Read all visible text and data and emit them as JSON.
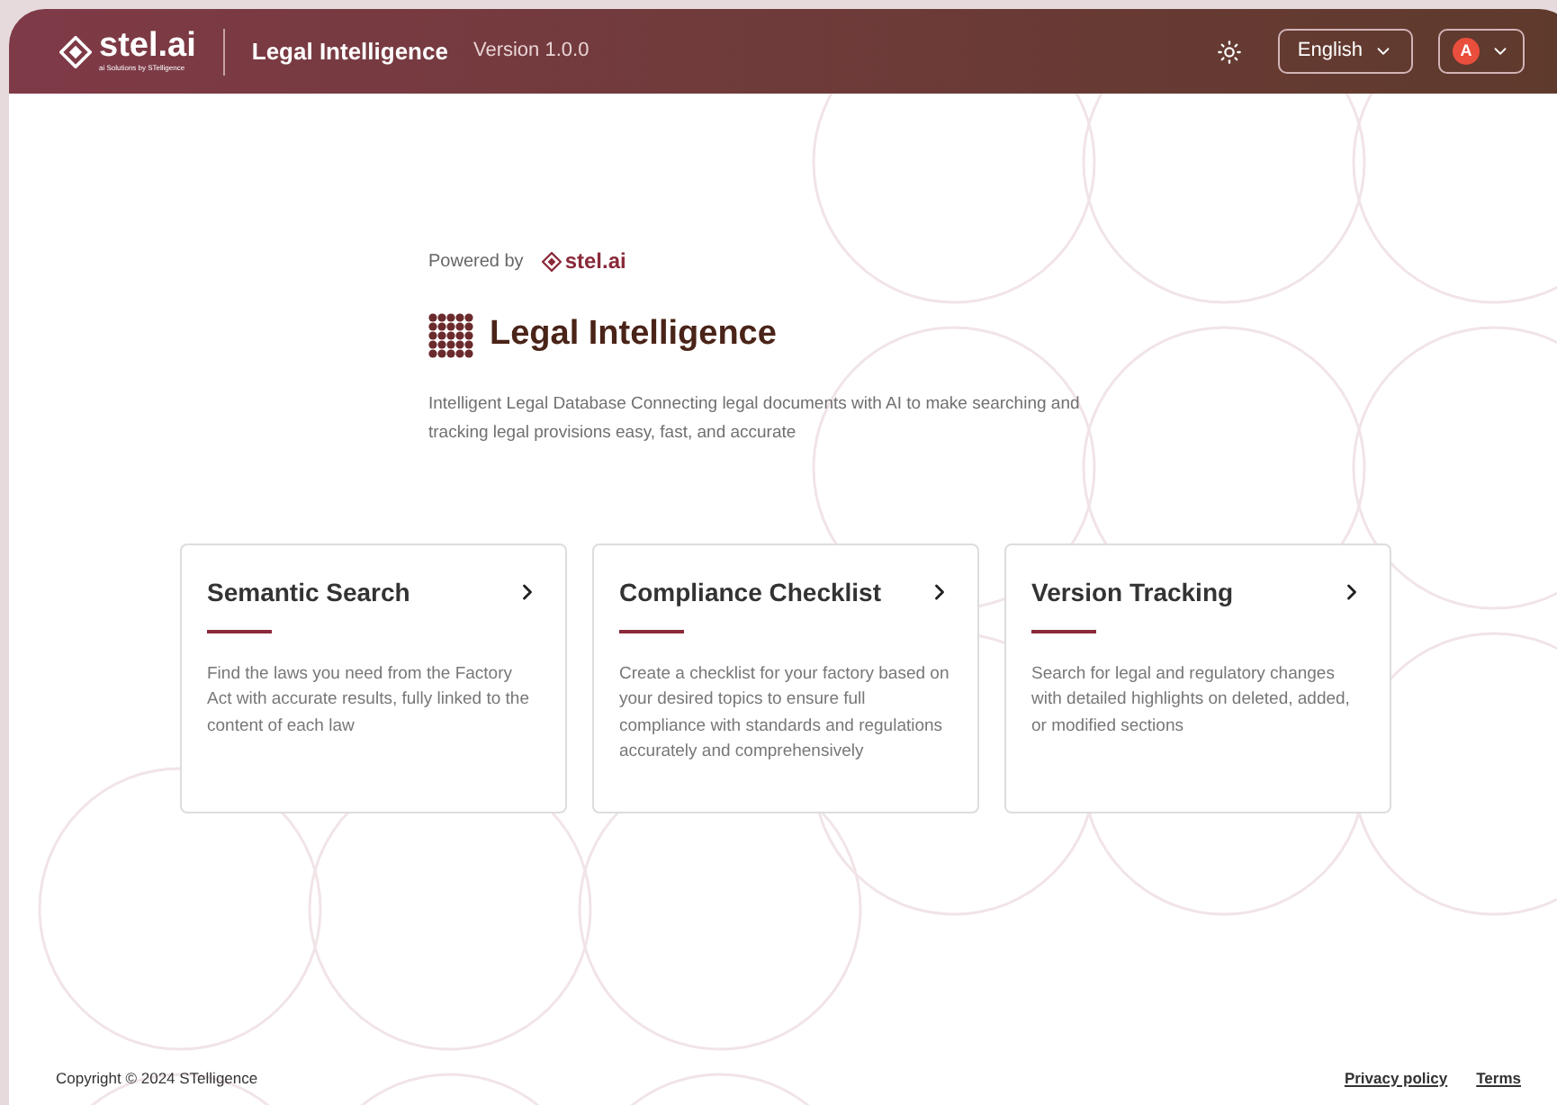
{
  "header": {
    "logo": "stel.ai",
    "logo_tagline": "ai Solutions by STelligence",
    "title": "Legal Intelligence",
    "version": "Version 1.0.0",
    "language": "English",
    "avatar": "A"
  },
  "hero": {
    "powered_by": "Powered by",
    "powered_logo": "stel.ai",
    "title": "Legal Intelligence",
    "description": "Intelligent Legal Database Connecting legal documents with AI to make searching and tracking legal provisions easy, fast, and accurate"
  },
  "cards": [
    {
      "title": "Semantic Search",
      "description": "Find the laws you need from the Factory Act with accurate results, fully linked to the content of each law"
    },
    {
      "title": "Compliance Checklist",
      "description": "Create a checklist for your factory based on your desired topics to ensure full compliance with standards and regulations accurately and comprehensively"
    },
    {
      "title": "Version Tracking",
      "description": "Search for legal and regulatory changes with detailed highlights on deleted, added, or modified sections"
    }
  ],
  "footer": {
    "copyright": "Copyright © 2024 STelligence",
    "links": [
      "Privacy policy",
      "Terms"
    ]
  }
}
